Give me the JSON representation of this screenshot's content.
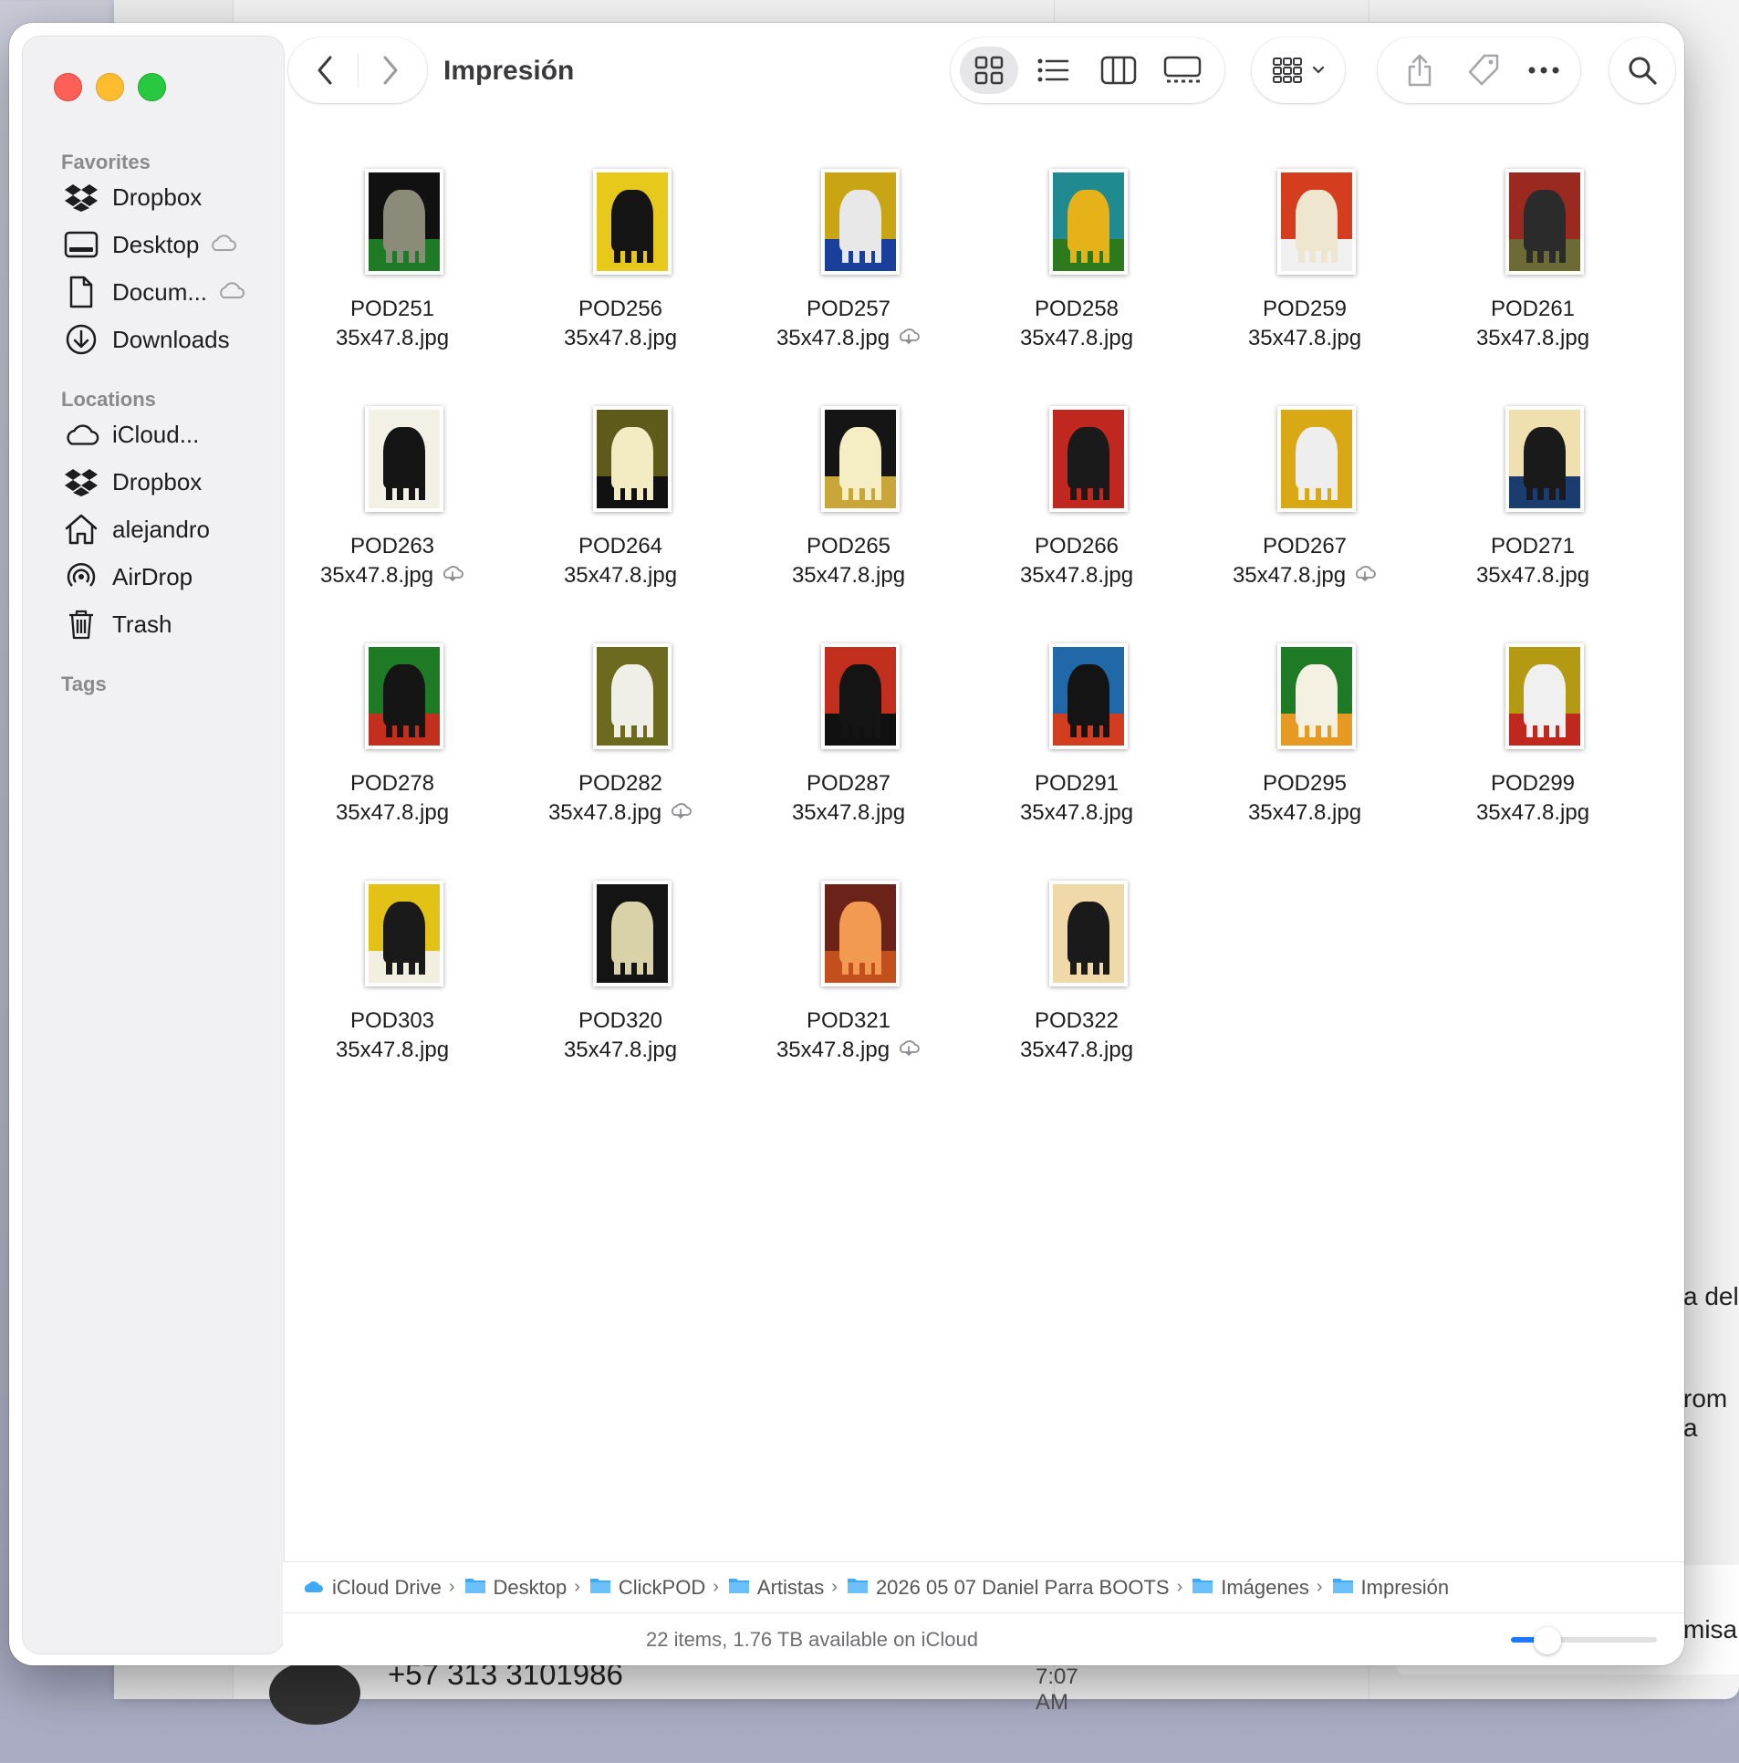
{
  "background": {
    "phone": "+57 313 3101986",
    "time": "7:07 AM",
    "snippets": [
      "a del",
      "rom a",
      "misa"
    ]
  },
  "window": {
    "title": "Impresión"
  },
  "sidebar": {
    "favorites_label": "Favorites",
    "locations_label": "Locations",
    "tags_label": "Tags",
    "favorites": [
      {
        "label": "Dropbox",
        "icon": "dropbox-icon",
        "cloud": false
      },
      {
        "label": "Desktop",
        "icon": "desktop-icon",
        "cloud": true
      },
      {
        "label": "Docum...",
        "icon": "document-icon",
        "cloud": true
      },
      {
        "label": "Downloads",
        "icon": "downloads-icon",
        "cloud": false
      }
    ],
    "locations": [
      {
        "label": "iCloud...",
        "icon": "icloud-icon"
      },
      {
        "label": "Dropbox",
        "icon": "dropbox-icon"
      },
      {
        "label": "alejandro",
        "icon": "home-icon"
      },
      {
        "label": "AirDrop",
        "icon": "airdrop-icon"
      },
      {
        "label": "Trash",
        "icon": "trash-icon"
      }
    ]
  },
  "files": [
    {
      "name": "POD251",
      "ext": "35x47.8.jpg",
      "cloud": false,
      "top": "#111111",
      "bottom": "#1f7a25",
      "figure": "#8c8a78"
    },
    {
      "name": "POD256",
      "ext": "35x47.8.jpg",
      "cloud": false,
      "top": "#e7c91b",
      "bottom": "#e7c91b",
      "figure": "#141414"
    },
    {
      "name": "POD257",
      "ext": "35x47.8.jpg",
      "cloud": true,
      "top": "#c9a514",
      "bottom": "#1a3f9a",
      "figure": "#e8e8e8"
    },
    {
      "name": "POD258",
      "ext": "35x47.8.jpg",
      "cloud": false,
      "top": "#1f8a8f",
      "bottom": "#2c7a1c",
      "figure": "#e5b21a"
    },
    {
      "name": "POD259",
      "ext": "35x47.8.jpg",
      "cloud": false,
      "top": "#d43d1d",
      "bottom": "#f0f0f0",
      "figure": "#efe6cf"
    },
    {
      "name": "POD261",
      "ext": "35x47.8.jpg",
      "cloud": false,
      "top": "#9a2a1f",
      "bottom": "#6d6b35",
      "figure": "#2b2b2b"
    },
    {
      "name": "POD263",
      "ext": "35x47.8.jpg",
      "cloud": true,
      "top": "#f3f0e6",
      "bottom": "#f3f0e6",
      "figure": "#141414"
    },
    {
      "name": "POD264",
      "ext": "35x47.8.jpg",
      "cloud": false,
      "top": "#5e5a1a",
      "bottom": "#111111",
      "figure": "#f3ecc3"
    },
    {
      "name": "POD265",
      "ext": "35x47.8.jpg",
      "cloud": false,
      "top": "#151515",
      "bottom": "#c9a63a",
      "figure": "#f5eec5"
    },
    {
      "name": "POD266",
      "ext": "35x47.8.jpg",
      "cloud": false,
      "top": "#c0281f",
      "bottom": "#c0281f",
      "figure": "#1a1a1a"
    },
    {
      "name": "POD267",
      "ext": "35x47.8.jpg",
      "cloud": true,
      "top": "#d9a915",
      "bottom": "#d9a915",
      "figure": "#eeeeee"
    },
    {
      "name": "POD271",
      "ext": "35x47.8.jpg",
      "cloud": false,
      "top": "#f0e0b0",
      "bottom": "#1b3c6e",
      "figure": "#1a1a1a"
    },
    {
      "name": "POD278",
      "ext": "35x47.8.jpg",
      "cloud": false,
      "top": "#1f7a25",
      "bottom": "#c22f1c",
      "figure": "#151515"
    },
    {
      "name": "POD282",
      "ext": "35x47.8.jpg",
      "cloud": true,
      "top": "#6b6a1e",
      "bottom": "#6b6a1e",
      "figure": "#efefe8"
    },
    {
      "name": "POD287",
      "ext": "35x47.8.jpg",
      "cloud": false,
      "top": "#c22f1c",
      "bottom": "#111111",
      "figure": "#141414"
    },
    {
      "name": "POD291",
      "ext": "35x47.8.jpg",
      "cloud": false,
      "top": "#2168a8",
      "bottom": "#d23d20",
      "figure": "#141414"
    },
    {
      "name": "POD295",
      "ext": "35x47.8.jpg",
      "cloud": false,
      "top": "#1f7a25",
      "bottom": "#e79a23",
      "figure": "#f4f1e3"
    },
    {
      "name": "POD299",
      "ext": "35x47.8.jpg",
      "cloud": false,
      "top": "#b49a12",
      "bottom": "#c0281f",
      "figure": "#f0f0f0"
    },
    {
      "name": "POD303",
      "ext": "35x47.8.jpg",
      "cloud": false,
      "top": "#e2c215",
      "bottom": "#f3efe0",
      "figure": "#1a1a1a"
    },
    {
      "name": "POD320",
      "ext": "35x47.8.jpg",
      "cloud": false,
      "top": "#141414",
      "bottom": "#141414",
      "figure": "#d9d2a8"
    },
    {
      "name": "POD321",
      "ext": "35x47.8.jpg",
      "cloud": true,
      "top": "#6b2219",
      "bottom": "#c2501d",
      "figure": "#f29a52"
    },
    {
      "name": "POD322",
      "ext": "35x47.8.jpg",
      "cloud": false,
      "top": "#f0d9a8",
      "bottom": "#f0d9a8",
      "figure": "#1a1a1a"
    }
  ],
  "pathbar": [
    {
      "label": "iCloud Drive",
      "icon": "icloud-drive-icon"
    },
    {
      "label": "Desktop",
      "icon": "folder-icon"
    },
    {
      "label": "ClickPOD",
      "icon": "folder-icon"
    },
    {
      "label": "Artistas",
      "icon": "folder-icon"
    },
    {
      "label": "2026 05 07 Daniel Parra BOOTS",
      "icon": "folder-icon"
    },
    {
      "label": "Imágenes",
      "icon": "folder-icon"
    },
    {
      "label": "Impresión",
      "icon": "folder-icon"
    }
  ],
  "status": {
    "text": "22 items, 1.76 TB available on iCloud",
    "zoom": 0.25
  },
  "colors": {
    "accent": "#1a7aff",
    "folder": "#3fa9f5"
  }
}
